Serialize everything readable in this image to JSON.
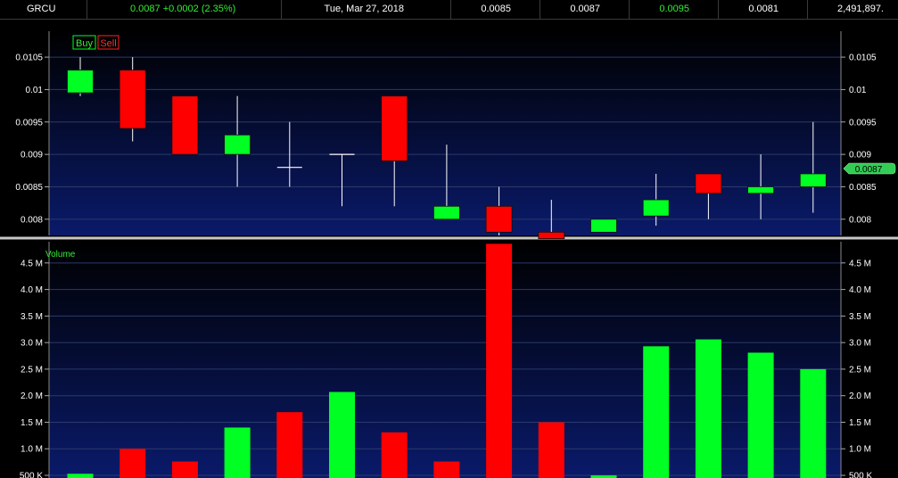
{
  "header": {
    "symbol": "GRCU",
    "last_change": "0.0087  +0.0002 (2.35%)",
    "date": "Tue, Mar 27, 2018",
    "open": "0.0085",
    "prev_or_mid": "0.0087",
    "high": "0.0095",
    "low": "0.0081",
    "volume": "2,491,897."
  },
  "colors": {
    "up": "#00ff22",
    "down": "#ff0000",
    "bg_top": "#000000",
    "bg_bottom": "#0a1a6a",
    "grid": "#2a3a6a",
    "price_badge": "#33cc55"
  },
  "legend": {
    "buy": "Buy",
    "sell": "Sell"
  },
  "volume_label": "Volume",
  "last_price_badge": "0.0087",
  "chart_data": [
    {
      "type": "candlestick",
      "price_ticks": [
        "0.0105",
        "0.01",
        "0.0095",
        "0.009",
        "0.0085",
        "0.008"
      ],
      "ylim": [
        0.00775,
        0.0109
      ],
      "candles": [
        {
          "open": 0.00995,
          "high": 0.0105,
          "low": 0.0099,
          "close": 0.0103
        },
        {
          "open": 0.0103,
          "high": 0.0105,
          "low": 0.0092,
          "close": 0.0094
        },
        {
          "open": 0.0099,
          "high": 0.0099,
          "low": 0.009,
          "close": 0.009
        },
        {
          "open": 0.009,
          "high": 0.0099,
          "low": 0.0085,
          "close": 0.0093
        },
        {
          "open": 0.0088,
          "high": 0.0095,
          "low": 0.0085,
          "close": 0.0088
        },
        {
          "open": 0.009,
          "high": 0.009,
          "low": 0.0082,
          "close": 0.009
        },
        {
          "open": 0.0099,
          "high": 0.0099,
          "low": 0.0082,
          "close": 0.0089
        },
        {
          "open": 0.008,
          "high": 0.00915,
          "low": 0.008,
          "close": 0.0082
        },
        {
          "open": 0.0082,
          "high": 0.0085,
          "low": 0.00775,
          "close": 0.0078
        },
        {
          "open": 0.0078,
          "high": 0.0083,
          "low": 0.0077,
          "close": 0.0077
        },
        {
          "open": 0.0078,
          "high": 0.008,
          "low": 0.0078,
          "close": 0.008
        },
        {
          "open": 0.00805,
          "high": 0.0087,
          "low": 0.0079,
          "close": 0.0083
        },
        {
          "open": 0.0087,
          "high": 0.0087,
          "low": 0.008,
          "close": 0.0084
        },
        {
          "open": 0.0084,
          "high": 0.009,
          "low": 0.008,
          "close": 0.0085
        },
        {
          "open": 0.0085,
          "high": 0.0095,
          "low": 0.0081,
          "close": 0.0087
        }
      ]
    },
    {
      "type": "bar",
      "ylabel": "Volume",
      "volume_ticks": [
        "4.5 M",
        "4.0 M",
        "3.5 M",
        "3.0 M",
        "2.5 M",
        "2.0 M",
        "1.5 M",
        "1.0 M",
        "500 K"
      ],
      "ylim": [
        450000,
        4900000
      ],
      "values": [
        530000,
        1000000,
        760000,
        1400000,
        1690000,
        2070000,
        1310000,
        760000,
        4860000,
        1500000,
        500000,
        2930000,
        3060000,
        2810000,
        2500000
      ],
      "colors": [
        "up",
        "down",
        "down",
        "up",
        "down",
        "up",
        "down",
        "down",
        "down",
        "down",
        "up",
        "up",
        "up",
        "up",
        "up"
      ]
    }
  ]
}
